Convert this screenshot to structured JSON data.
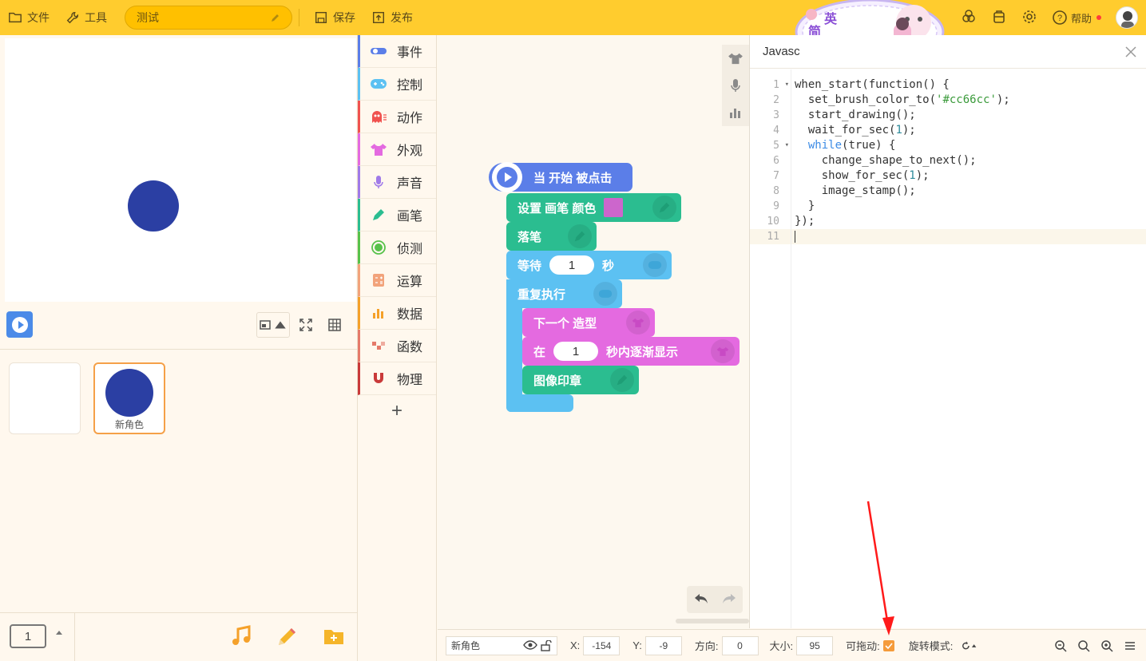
{
  "topbar": {
    "file_label": "文件",
    "tools_label": "工具",
    "project_name": "测试",
    "save_label": "保存",
    "publish_label": "发布",
    "help_label": "帮助"
  },
  "mascot": {
    "lang1": "英",
    "lang2": "简"
  },
  "sprites": {
    "sprite_name": "新角色"
  },
  "pager": {
    "page": "1"
  },
  "categories": [
    {
      "label": "事件",
      "color": "#5b7ee8"
    },
    {
      "label": "控制",
      "color": "#5cc1f2"
    },
    {
      "label": "动作",
      "color": "#f0524f"
    },
    {
      "label": "外观",
      "color": "#e46ae0"
    },
    {
      "label": "声音",
      "color": "#a07ae8"
    },
    {
      "label": "画笔",
      "color": "#2bbd90"
    },
    {
      "label": "侦测",
      "color": "#57c24a"
    },
    {
      "label": "运算",
      "color": "#f2a37b"
    },
    {
      "label": "数据",
      "color": "#f5a12a"
    },
    {
      "label": "函数",
      "color": "#e57a6a"
    },
    {
      "label": "物理",
      "color": "#c93a3a"
    }
  ],
  "blocks": {
    "start": "当 开始 被点击",
    "set_brush_color": "设置 画笔 颜色",
    "pen_down": "落笔",
    "wait": "等待",
    "wait_value": "1",
    "wait_unit": "秒",
    "forever": "重复执行",
    "next_costume": "下一个 造型",
    "in": "在",
    "fade_value": "1",
    "fade_text": "秒内逐渐显示",
    "stamp": "图像印章"
  },
  "editor": {
    "title": "Javasc",
    "lines": [
      "1",
      "2",
      "3",
      "4",
      "5",
      "6",
      "7",
      "8",
      "9",
      "10",
      "11"
    ]
  },
  "propbar": {
    "name": "新角色",
    "x_label": "X:",
    "x_value": "-154",
    "y_label": "Y:",
    "y_value": "-9",
    "dir_label": "方向:",
    "dir_value": "0",
    "size_label": "大小:",
    "size_value": "95",
    "drag_label": "可拖动:",
    "rotate_label": "旋转模式:"
  },
  "colors": {
    "topbar": "#ffcc2e",
    "sprite": "#2b3fa3",
    "events_block": "#5b7ee8",
    "pen_block": "#2bbd90",
    "control_block": "#5cc1f2",
    "looks_block": "#e46ae0",
    "brush_color": "#cc66cc"
  }
}
